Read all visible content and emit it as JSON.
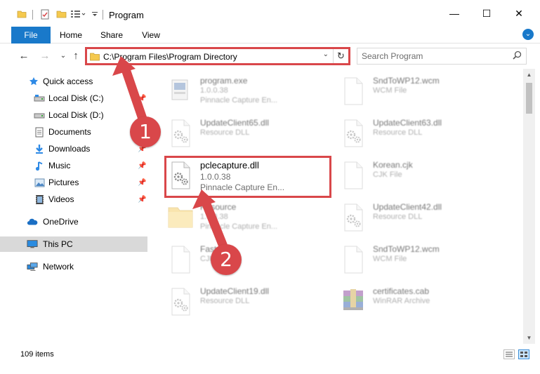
{
  "window": {
    "title": "Program",
    "minimize_glyph": "—",
    "maximize_glyph": "☐",
    "close_glyph": "✕"
  },
  "ribbon": {
    "tabs": [
      "File",
      "Home",
      "Share",
      "View"
    ],
    "expand_glyph": "⌄"
  },
  "address": {
    "path": "C:\\Program Files\\Program Directory",
    "dropdown_glyph": "⌄",
    "refresh_glyph": "↻"
  },
  "search": {
    "placeholder": "Search Program"
  },
  "nav": {
    "back_glyph": "←",
    "forward_glyph": "→",
    "recent_glyph": "⌄",
    "up_glyph": "↑"
  },
  "sidebar": {
    "quick_access": "Quick access",
    "items": [
      {
        "label": "Local Disk (C:)",
        "icon": "drive-icon",
        "pinned": true
      },
      {
        "label": "Local Disk (D:)",
        "icon": "drive-icon",
        "pinned": false
      },
      {
        "label": "Documents",
        "icon": "documents-icon",
        "pinned": true
      },
      {
        "label": "Downloads",
        "icon": "downloads-icon",
        "pinned": true
      },
      {
        "label": "Music",
        "icon": "music-icon",
        "pinned": true
      },
      {
        "label": "Pictures",
        "icon": "pictures-icon",
        "pinned": true
      },
      {
        "label": "Videos",
        "icon": "videos-icon",
        "pinned": true
      }
    ],
    "onedrive": "OneDrive",
    "this_pc": "This PC",
    "network": "Network",
    "pin_glyph": "📌"
  },
  "files": [
    {
      "name": "program.exe",
      "line2": "1.0.0.38",
      "line3": "Pinnacle Capture En...",
      "icon": "exe-icon",
      "faded": true
    },
    {
      "name": "SndToWP12.wcm",
      "line2": "WCM File",
      "line3": "",
      "icon": "file-icon",
      "faded": true
    },
    {
      "name": "UpdateClient65.dll",
      "line2": "Resource DLL",
      "line3": "",
      "icon": "dll-icon",
      "faded": true
    },
    {
      "name": "UpdateClient63.dll",
      "line2": "Resource DLL",
      "line3": "",
      "icon": "dll-icon",
      "faded": true
    },
    {
      "name": "pclecapture.dll",
      "line2": "1.0.0.38",
      "line3": "Pinnacle Capture En...",
      "icon": "dll-icon",
      "faded": false
    },
    {
      "name": "Korean.cjk",
      "line2": "CJK File",
      "line3": "",
      "icon": "file-icon",
      "faded": true
    },
    {
      "name": "Resource",
      "line2": "1.0.0.38",
      "line3": "Pinnacle Capture En...",
      "icon": "folder-icon",
      "faded": true
    },
    {
      "name": "UpdateClient42.dll",
      "line2": "Resource DLL",
      "line3": "",
      "icon": "dll-icon",
      "faded": true
    },
    {
      "name": "Fast...cjk",
      "line2": "CJK",
      "line3": "",
      "icon": "file-icon",
      "faded": true
    },
    {
      "name": "SndToWP12.wcm",
      "line2": "WCM File",
      "line3": "",
      "icon": "file-icon",
      "faded": true
    },
    {
      "name": "UpdateClient19.dll",
      "line2": "Resource DLL",
      "line3": "",
      "icon": "dll-icon",
      "faded": true
    },
    {
      "name": "certificates.cab",
      "line2": "WinRAR Archive",
      "line3": "",
      "icon": "winrar-icon",
      "faded": true
    }
  ],
  "status": {
    "item_count": "109 items"
  },
  "annotations": {
    "step1": "1",
    "step2": "2",
    "color": "#d9474a"
  },
  "colors": {
    "accent": "#1979ca",
    "selection": "#cce8ff",
    "highlight": "#d9474a"
  }
}
